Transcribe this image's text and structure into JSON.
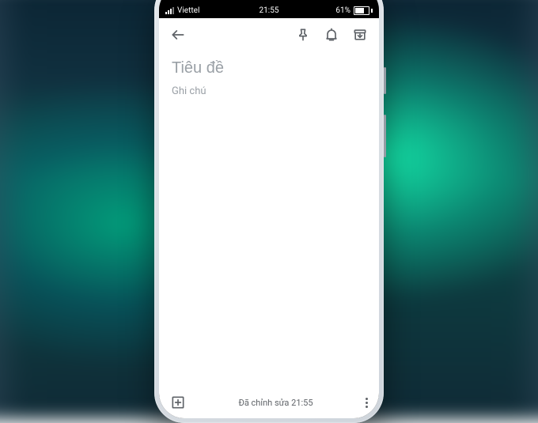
{
  "status": {
    "carrier": "Viettel",
    "time": "21:55",
    "battery_pct": "61%"
  },
  "note": {
    "title_placeholder": "Tiêu đề",
    "title_value": "",
    "body_placeholder": "Ghi chú",
    "body_value": ""
  },
  "footer": {
    "edited_label": "Đã chỉnh sửa 21:55"
  },
  "icons": {
    "back": "back-arrow-icon",
    "pin": "pin-icon",
    "reminder": "reminder-bell-icon",
    "archive": "archive-icon",
    "add": "add-box-icon",
    "overflow": "more-vert-icon"
  }
}
